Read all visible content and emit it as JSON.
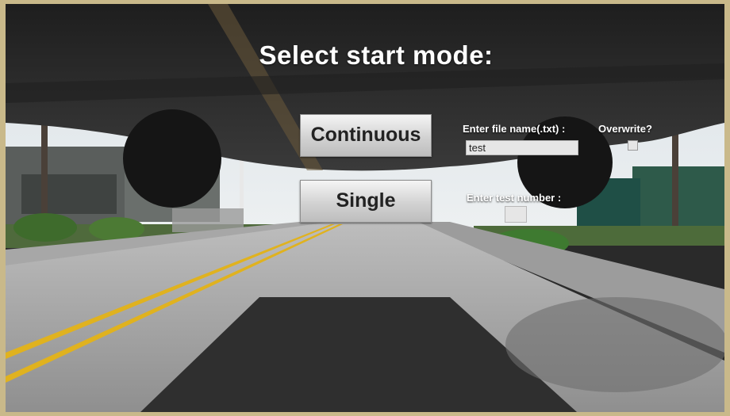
{
  "app": {
    "title": "Select start mode:"
  },
  "buttons": {
    "continuous_label": "Continuous",
    "single_label": "Single"
  },
  "file": {
    "label": "Enter file name(.txt) :",
    "value": "test"
  },
  "overwrite": {
    "label": "Overwrite?",
    "checked": false
  },
  "test_number": {
    "label": "Enter test number :",
    "value": ""
  },
  "colors": {
    "frame_border": "#c9b98a",
    "button_face": "#d2d2d2",
    "input_bg": "#e6e6e6",
    "road_line": "#e0b21f"
  }
}
